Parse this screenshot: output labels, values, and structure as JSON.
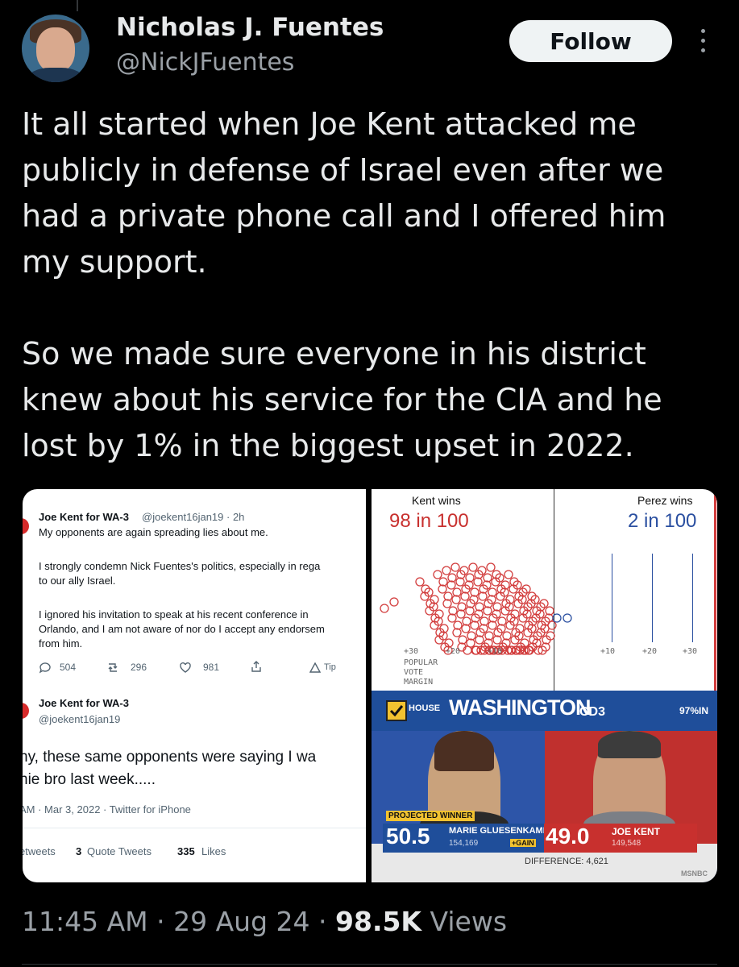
{
  "author": {
    "name": "Nicholas J. Fuentes",
    "handle": "@NickJFuentes",
    "follow_label": "Follow"
  },
  "tweet": {
    "text": "It all started when Joe Kent attacked me publicly in defense of Israel even after we had a private phone call and I offered him my support.\n\nSo we made sure everyone in his district knew about his service for the CIA and he lost by 1% in the biggest upset in 2022."
  },
  "media_left": {
    "tweet1": {
      "name": "Joe Kent for WA-3",
      "handle_time": "@joekent16jan19 · 2h",
      "line1": "My opponents are again spreading lies about me.",
      "line2": "I strongly condemn Nick Fuentes's politics, especially in rega",
      "line3": "to our ally Israel.",
      "line4": "I ignored his invitation to speak at his recent conference in",
      "line5": "Orlando, and I am not aware of nor do I accept any endorsem",
      "line6": "from him.",
      "replies": "504",
      "retweets": "296",
      "likes": "981",
      "tip": "Tip"
    },
    "tweet2": {
      "name": "Joe Kent for WA-3",
      "handle": "@joekent16jan19",
      "line1": "ny, these same opponents were saying I wa",
      "line2": "nie bro last week.....",
      "meta": "AM · Mar 3, 2022 · Twitter for iPhone",
      "retweets_label": "etweets",
      "quote_count": "3",
      "quote_label": "Quote Tweets",
      "likes_count": "335",
      "likes_label": "Likes"
    }
  },
  "media_right_top": {
    "kent_label": "Kent wins",
    "kent_odds": "98 in 100",
    "perez_label": "Perez wins",
    "perez_odds": "2 in 100",
    "axis_left": [
      "+30",
      "+20",
      "+10"
    ],
    "axis_right": [
      "+10",
      "+20",
      "+30"
    ],
    "popular": "POPULAR",
    "vote": "VOTE",
    "margin": "MARGIN",
    "colors": {
      "kent": "#d23c3c",
      "perez": "#2a4fa0"
    }
  },
  "media_right_bottom": {
    "house": "HOUSE",
    "state": "WASHINGTON",
    "district": "CD3",
    "reporting": "97%IN",
    "projected": "PROJECTED WINNER",
    "perez_pct": "50.5",
    "perez_name": "MARIE GLUESENKAMP PEREZ",
    "perez_votes": "154,169",
    "gain": "+GAIN",
    "kent_pct": "49.0",
    "kent_name": "JOE KENT",
    "kent_votes": "149,548",
    "difference": "DIFFERENCE: 4,621",
    "network": "MSNBC"
  },
  "footer": {
    "time": "11:45 AM",
    "sep1": " · ",
    "date": "29 Aug 24",
    "sep2": " · ",
    "views_count": "98.5K",
    "views_label": " Views"
  }
}
